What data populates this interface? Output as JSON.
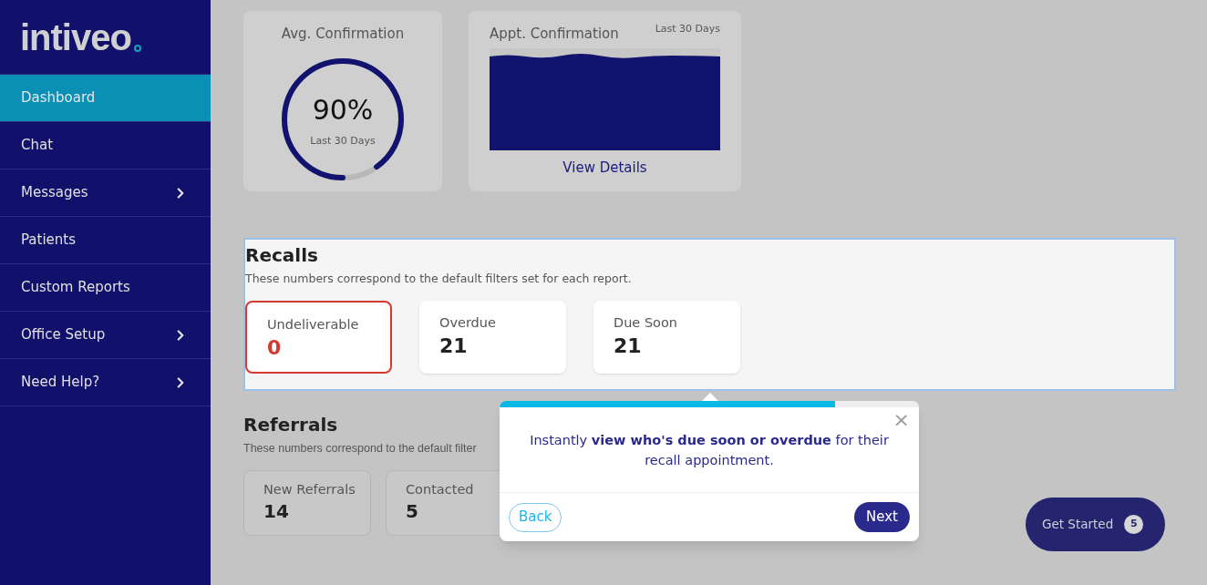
{
  "sidebar": {
    "logo": "intiveo",
    "items": [
      {
        "label": "Dashboard",
        "selected": true,
        "expandable": false
      },
      {
        "label": "Chat",
        "selected": false,
        "expandable": false
      },
      {
        "label": "Messages",
        "selected": false,
        "expandable": true
      },
      {
        "label": "Patients",
        "selected": false,
        "expandable": false
      },
      {
        "label": "Custom Reports",
        "selected": false,
        "expandable": false
      },
      {
        "label": "Office Setup",
        "selected": false,
        "expandable": true
      },
      {
        "label": "Need Help?",
        "selected": false,
        "expandable": true
      }
    ]
  },
  "avg_confirmation": {
    "title": "Avg. Confirmation",
    "value": "90%",
    "period": "Last 30 Days"
  },
  "appt_confirmation": {
    "title": "Appt. Confirmation",
    "period": "Last 30 Days",
    "link": "View Details"
  },
  "recalls": {
    "title": "Recalls",
    "description": "These numbers correspond to the default filters set for each report.",
    "cards": [
      {
        "label": "Undeliverable",
        "value": "0",
        "alert": true
      },
      {
        "label": "Overdue",
        "value": "21",
        "alert": false
      },
      {
        "label": "Due Soon",
        "value": "21",
        "alert": false
      }
    ]
  },
  "referrals": {
    "title": "Referrals",
    "description": "These numbers correspond to the default filter",
    "cards": [
      {
        "label": "New Referrals",
        "value": "14"
      },
      {
        "label": "Contacted",
        "value": "5"
      }
    ]
  },
  "tour_popup": {
    "level": 0.8,
    "close": "×",
    "message": "Instantly **view who's due soon or overdue** for their recall appointment.",
    "back": "Back",
    "next": "Next"
  },
  "get_started": {
    "label": "Get Started",
    "count": "5"
  }
}
